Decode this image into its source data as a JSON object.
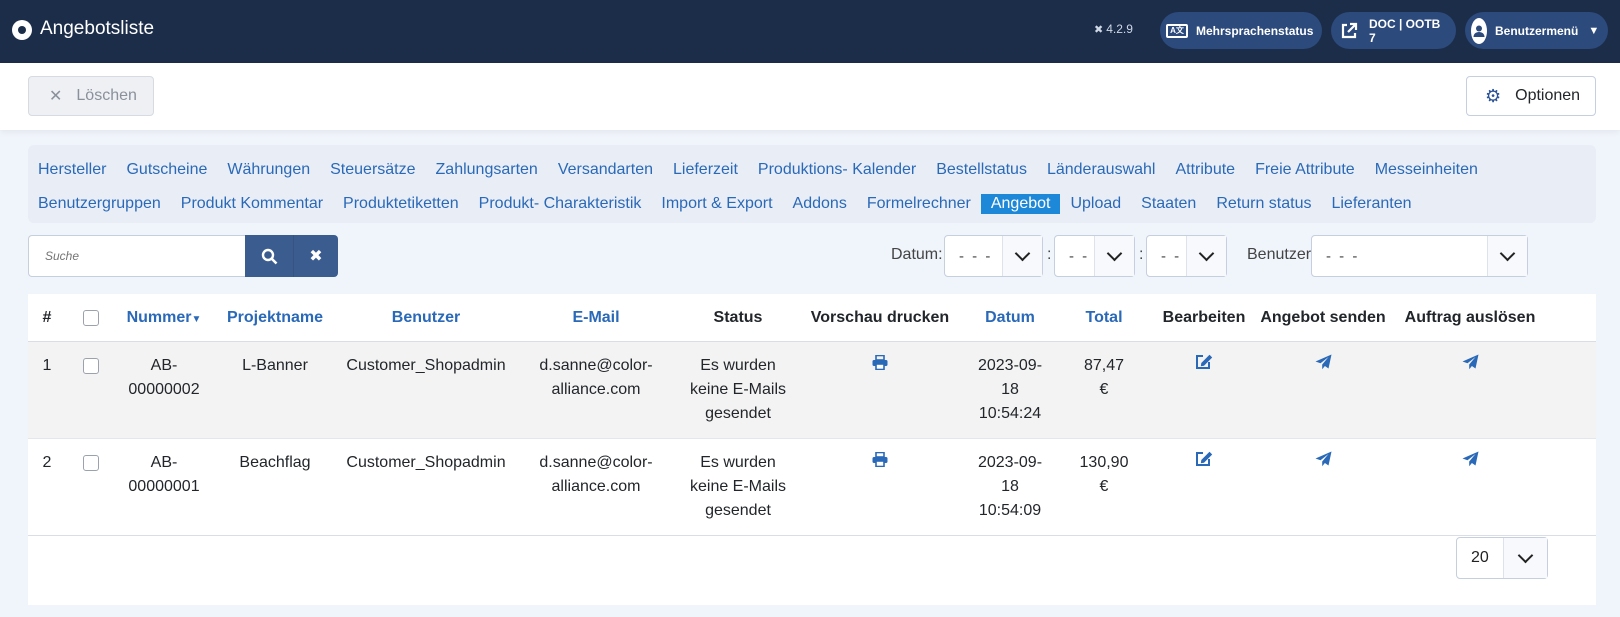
{
  "header": {
    "title": "Angebotsliste",
    "version": "4.2.9",
    "lang_status": "Mehrsprachenstatus",
    "doc": "DOC | OOTB 7",
    "user_menu": "Benutzermenü"
  },
  "toolbar": {
    "delete_label": "Löschen",
    "options_label": "Optionen"
  },
  "nav": {
    "row1": [
      "Hersteller",
      "Gutscheine",
      "Währungen",
      "Steuersätze",
      "Zahlungsarten",
      "Versandarten",
      "Lieferzeit",
      "Produktions- Kalender",
      "Bestellstatus",
      "Länderauswahl",
      "Attribute",
      "Freie Attribute",
      "Messeinheiten"
    ],
    "row2": [
      "Benutzergruppen",
      "Produkt Kommentar",
      "Produktetiketten",
      "Produkt- Charakteristik",
      "Import & Export",
      "Addons",
      "Formelrechner",
      "Angebot",
      "Upload",
      "Staaten",
      "Return status",
      "Lieferanten"
    ],
    "active": "Angebot"
  },
  "filters": {
    "search_placeholder": "Suche",
    "date_label": "Datum:",
    "day_value": "- - -",
    "month_value": "- -",
    "year_value": "- -",
    "colon": ":",
    "user_label": "Benutzer",
    "user_value": "- - -"
  },
  "table": {
    "headers": {
      "num": "#",
      "nummer": "Nummer",
      "projekt": "Projektname",
      "benutzer": "Benutzer",
      "email": "E-Mail",
      "status": "Status",
      "vorschau": "Vorschau drucken",
      "datum": "Datum",
      "total": "Total",
      "bearbeiten": "Bearbeiten",
      "senden": "Angebot senden",
      "auftrag": "Auftrag auslösen"
    },
    "rows": [
      {
        "index": "1",
        "nummer_1": "AB-",
        "nummer_2": "00000002",
        "projekt": "L-Banner",
        "benutzer": "Customer_Shopadmin",
        "email_1": "d.sanne@color-",
        "email_2": "alliance.com",
        "status_1": "Es wurden",
        "status_2": "keine E-Mails",
        "status_3": "gesendet",
        "datum_1": "2023-09-",
        "datum_2": "18",
        "datum_3": "10:54:24",
        "total_1": "87,47",
        "total_2": "€"
      },
      {
        "index": "2",
        "nummer_1": "AB-",
        "nummer_2": "00000001",
        "projekt": "Beachflag",
        "benutzer": "Customer_Shopadmin",
        "email_1": "d.sanne@color-",
        "email_2": "alliance.com",
        "status_1": "Es wurden",
        "status_2": "keine E-Mails",
        "status_3": "gesendet",
        "datum_1": "2023-09-",
        "datum_2": "18",
        "datum_3": "10:54:09",
        "total_1": "130,90",
        "total_2": "€"
      }
    ]
  },
  "pagination": {
    "limit": "20"
  }
}
